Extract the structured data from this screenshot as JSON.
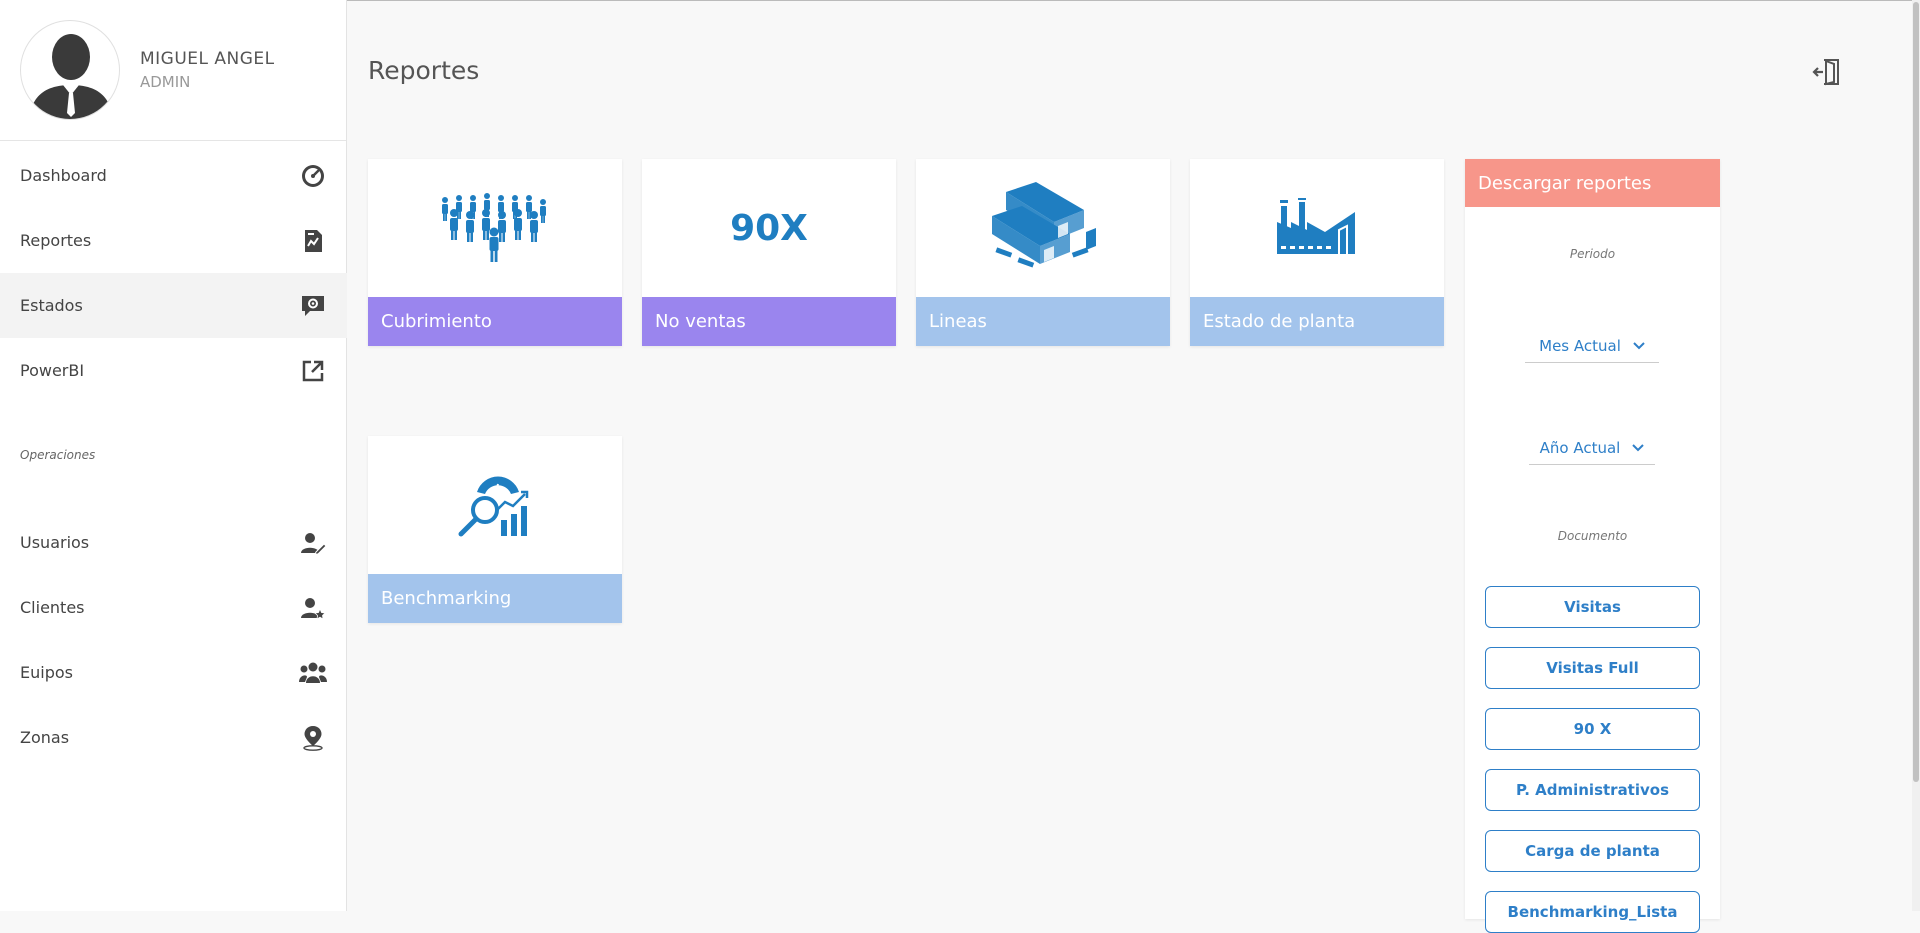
{
  "user": {
    "name": "MIGUEL ANGEL",
    "role": "ADMIN"
  },
  "sidebar": {
    "items": [
      {
        "label": "Dashboard",
        "icon": "gauge-icon"
      },
      {
        "label": "Reportes",
        "icon": "report-icon"
      },
      {
        "label": "Estados",
        "icon": "chat-gear-icon"
      },
      {
        "label": "PowerBI",
        "icon": "external-link-icon"
      }
    ],
    "section_label": "Operaciones",
    "ops": [
      {
        "label": "Usuarios",
        "icon": "user-edit-icon"
      },
      {
        "label": "Clientes",
        "icon": "user-star-icon"
      },
      {
        "label": "Euipos",
        "icon": "team-icon"
      },
      {
        "label": "Zonas",
        "icon": "map-pin-icon"
      }
    ]
  },
  "header": {
    "title": "Reportes"
  },
  "cards": [
    {
      "label": "Cubrimiento",
      "icon": "crowd-icon"
    },
    {
      "label": "No ventas",
      "icon_text": "90X"
    },
    {
      "label": "Lineas",
      "icon": "pipes-icon"
    },
    {
      "label": "Estado de planta",
      "icon": "factory-icon"
    },
    {
      "label": "Benchmarking",
      "icon": "analytics-icon"
    }
  ],
  "panel": {
    "title": "Descargar reportes",
    "period_label": "Periodo",
    "month_select": "Mes Actual",
    "year_select": "Año Actual",
    "document_label": "Documento",
    "buttons": [
      "Visitas",
      "Visitas Full",
      "90 X",
      "P. Administrativos",
      "Carga de planta",
      "Benchmarking_Lista"
    ]
  },
  "colors": {
    "accent_blue": "#2e7fc8",
    "purple": "#9a85ee",
    "light_blue": "#a3c4ec",
    "salmon": "#f7968a"
  }
}
